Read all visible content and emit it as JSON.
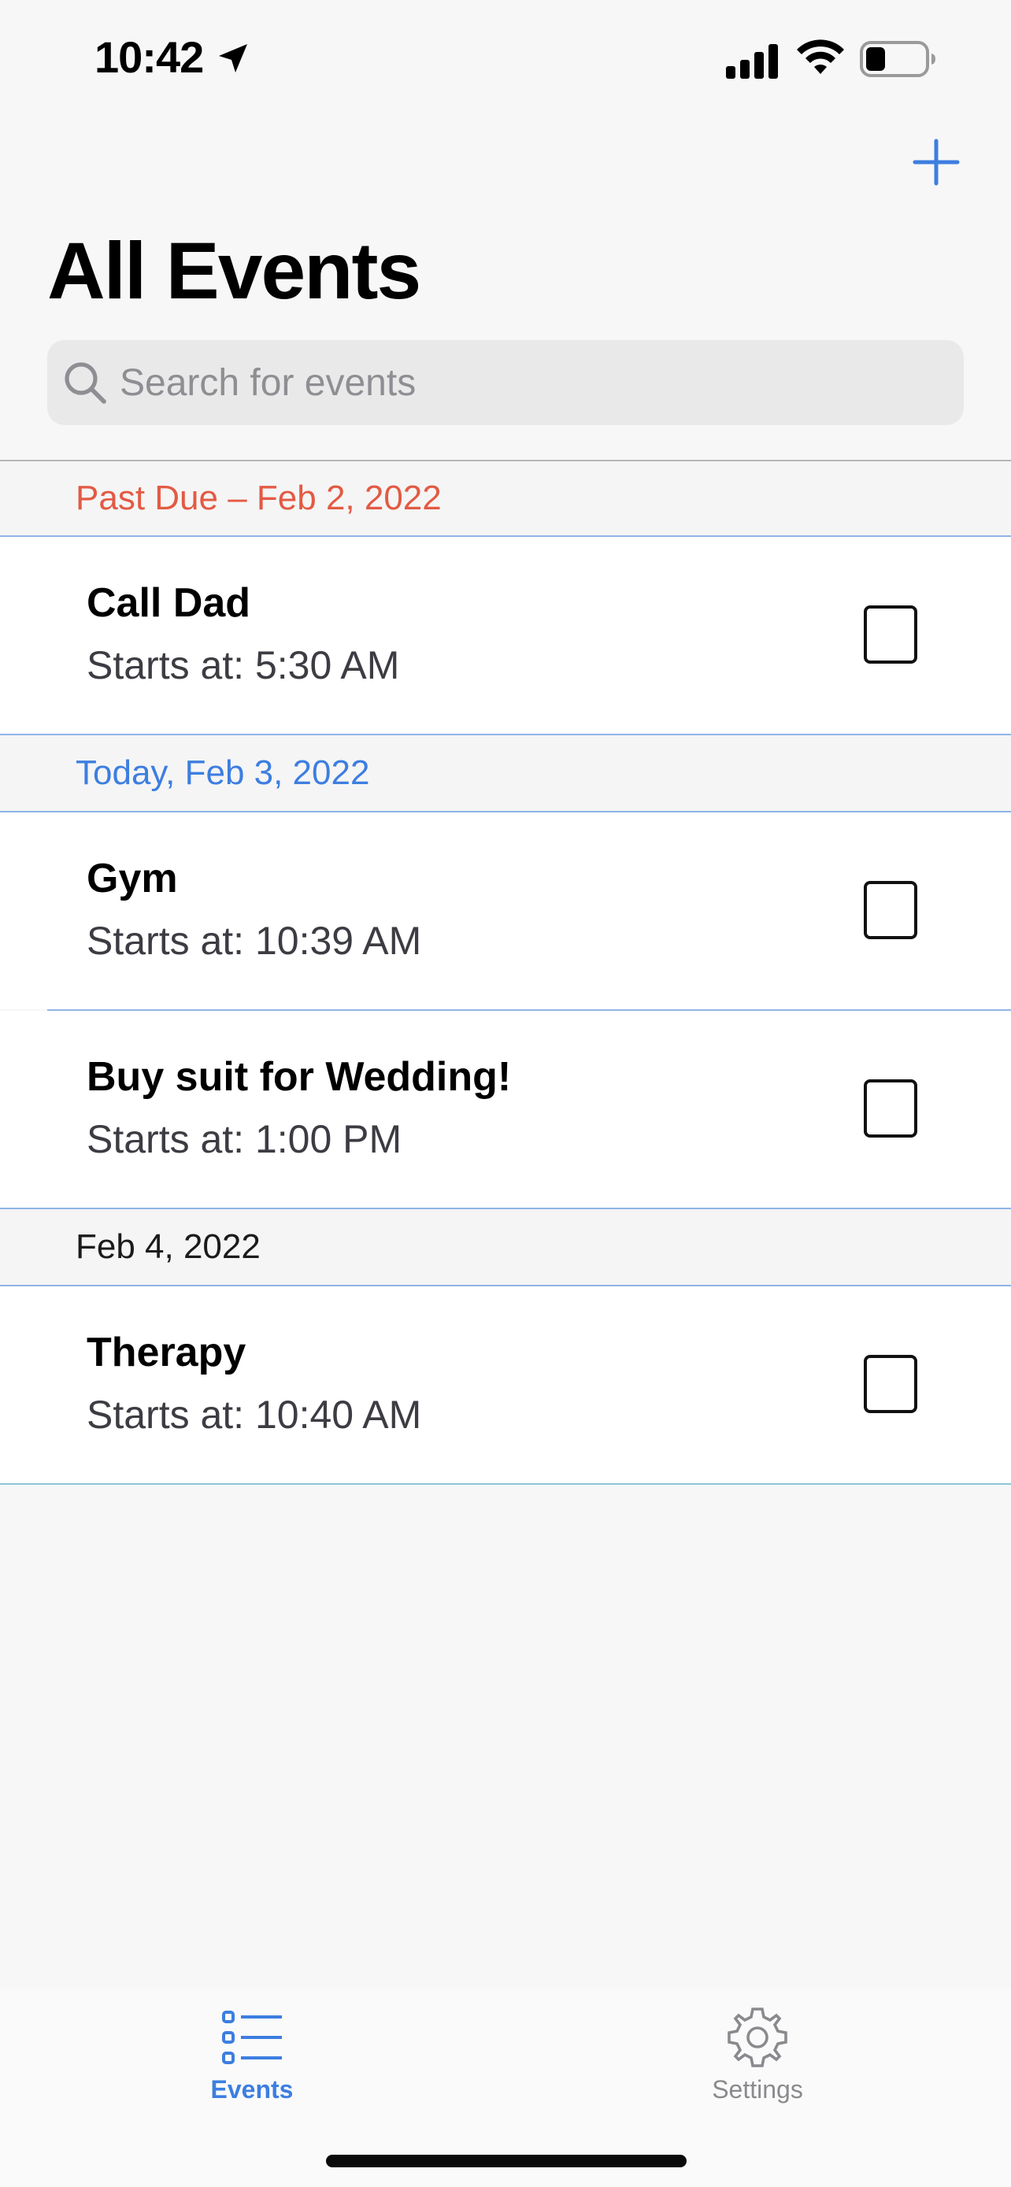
{
  "status_bar": {
    "time": "10:42"
  },
  "nav": {
    "title": "All Events",
    "add_icon": "plus-icon"
  },
  "search": {
    "placeholder": "Search for events",
    "value": ""
  },
  "sections": [
    {
      "header": "Past Due – Feb 2, 2022",
      "header_color": "#e35a43",
      "events": [
        {
          "title": "Call Dad",
          "subtitle": "Starts at: 5:30 AM",
          "checked": false
        }
      ]
    },
    {
      "header": "Today, Feb 3, 2022",
      "header_color": "#3d7ee0",
      "events": [
        {
          "title": "Gym",
          "subtitle": "Starts at: 10:39 AM",
          "checked": false
        },
        {
          "title": "Buy suit for Wedding!",
          "subtitle": "Starts at: 1:00 PM",
          "checked": false
        }
      ]
    },
    {
      "header": "Feb 4, 2022",
      "header_color": "#1b1b1b",
      "events": [
        {
          "title": "Therapy",
          "subtitle": "Starts at: 10:40 AM",
          "checked": false
        }
      ]
    }
  ],
  "tab_bar": {
    "tabs": [
      {
        "label": "Events",
        "icon": "list-icon",
        "selected": true
      },
      {
        "label": "Settings",
        "icon": "gear-icon",
        "selected": false
      }
    ]
  },
  "colors": {
    "accent": "#3d7ee0",
    "past_due": "#e35a43",
    "divider": "#90b4e6"
  }
}
